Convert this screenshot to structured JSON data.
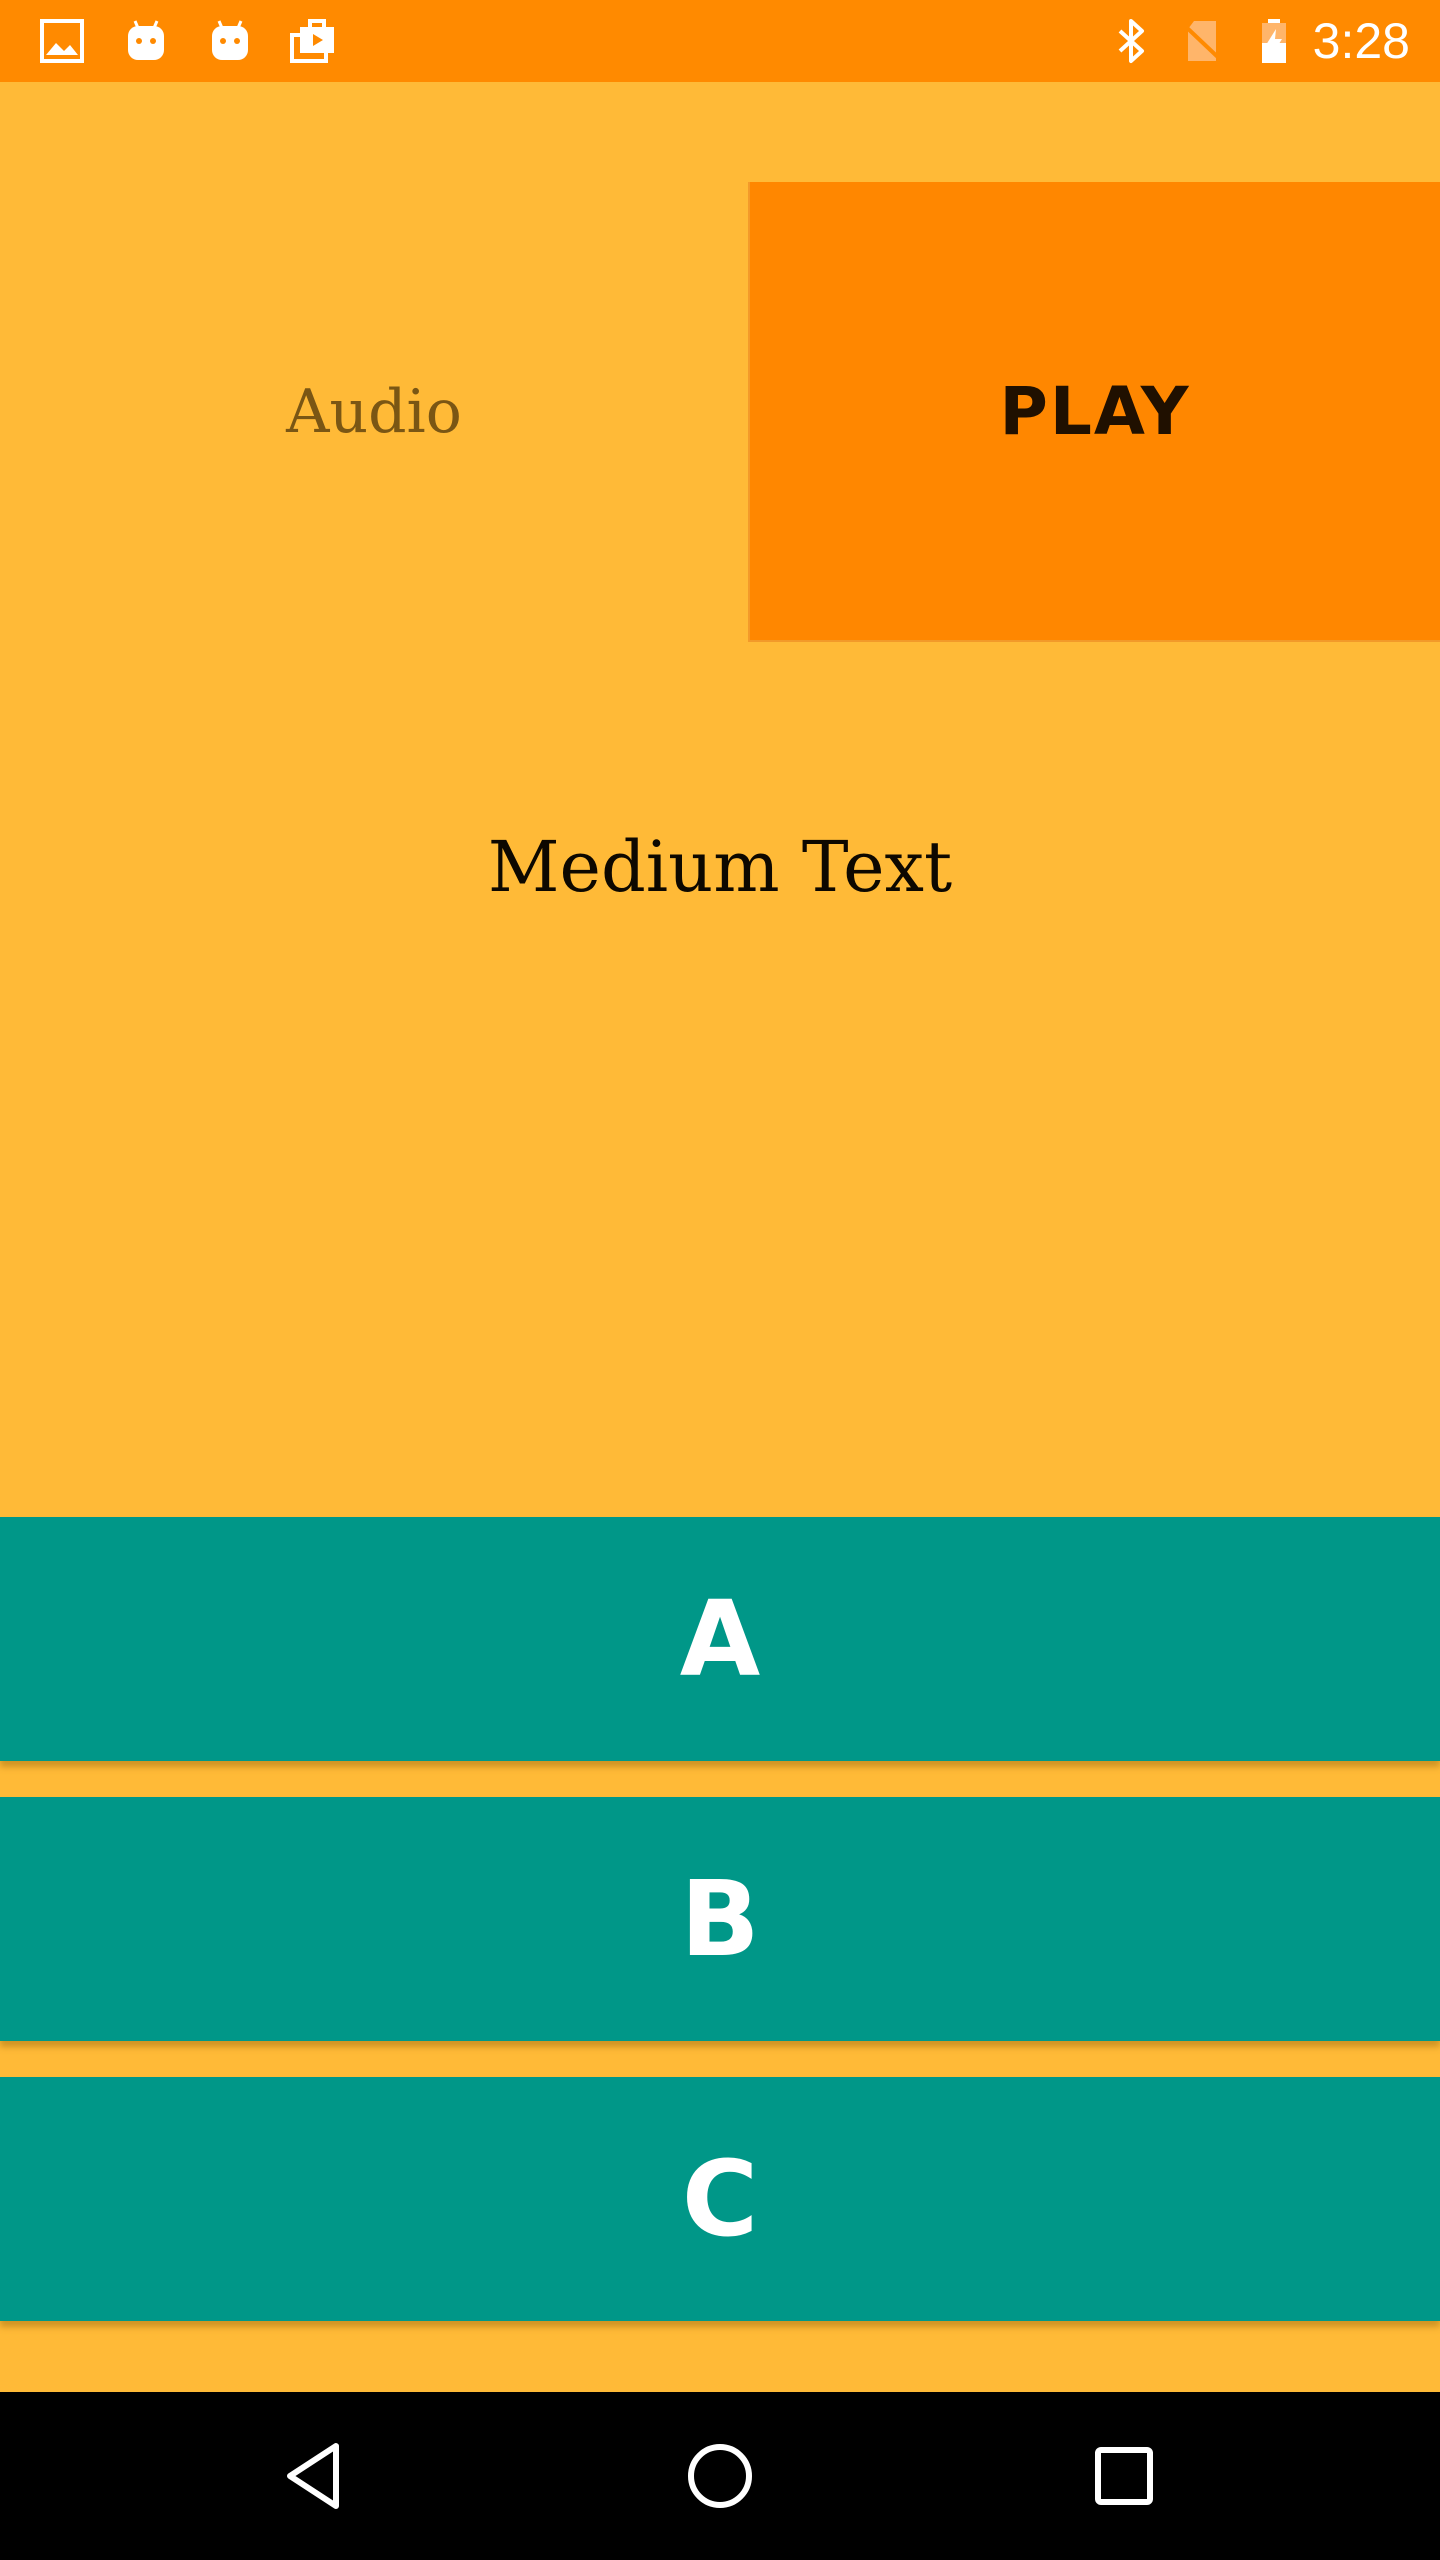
{
  "status_bar": {
    "time": "3:28",
    "left_icons": [
      "image-notification-icon",
      "android-notification-icon",
      "android-notification-icon",
      "work-notification-icon"
    ],
    "right_icons": [
      "bluetooth-icon",
      "no-sim-icon",
      "battery-charging-icon"
    ],
    "background_color": "#FF8A00"
  },
  "main": {
    "audio_label": "Audio",
    "play_button_label": "PLAY",
    "medium_text": "Medium Text",
    "background_color": "#FFBA37",
    "play_button_color": "#FF8700"
  },
  "choices": {
    "a": "A",
    "b": "B",
    "c": "C",
    "color": "#009788"
  },
  "navigation": {
    "buttons": [
      "back-icon",
      "home-icon",
      "recents-icon"
    ]
  }
}
